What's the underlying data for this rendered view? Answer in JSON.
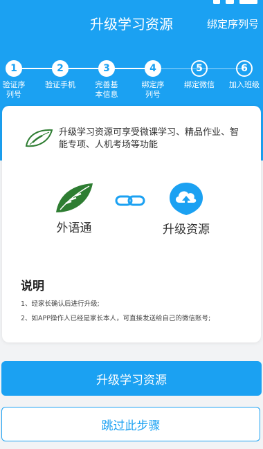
{
  "header": {
    "title": "升级学习资源",
    "right_link": "绑定序列号"
  },
  "steps": [
    {
      "num": "1",
      "label": "验证序列号",
      "done": true
    },
    {
      "num": "2",
      "label": "验证手机",
      "done": true
    },
    {
      "num": "3",
      "label": "完善基本信息",
      "done": true
    },
    {
      "num": "4",
      "label": "绑定序列号",
      "done": true
    },
    {
      "num": "5",
      "label": "绑定微信",
      "done": false
    },
    {
      "num": "6",
      "label": "加入班级",
      "done": false
    }
  ],
  "card": {
    "intro": "升级学习资源可享受微课学习、精品作业、智能专项、人机考场等功能",
    "app_left_label": "外语通",
    "app_right_label": "升级资源",
    "section_title": "说明",
    "notes": [
      "1、经家长确认后进行升级;",
      "2、如APP操作人已经是家长本人，可直接发送给自己的微信账号;"
    ]
  },
  "buttons": {
    "primary": "升级学习资源",
    "secondary": "跳过此步骤"
  },
  "colors": {
    "brand_blue": "#1ba1f2",
    "leaf_green": "#2e7d32"
  }
}
